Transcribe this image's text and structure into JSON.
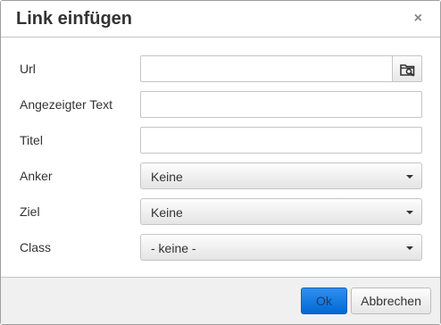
{
  "dialog": {
    "title": "Link einfügen",
    "close_symbol": "×"
  },
  "fields": {
    "url": {
      "label": "Url",
      "value": "",
      "browse_icon": "folder-search-icon"
    },
    "text": {
      "label": "Angezeigter Text",
      "value": ""
    },
    "title": {
      "label": "Titel",
      "value": ""
    },
    "anchor": {
      "label": "Anker",
      "selected": "Keine"
    },
    "target": {
      "label": "Ziel",
      "selected": "Keine"
    },
    "class": {
      "label": "Class",
      "selected": "- keine -"
    }
  },
  "buttons": {
    "ok": "Ok",
    "cancel": "Abbrechen"
  },
  "colors": {
    "primary": "#0069d4",
    "border": "#c5c5c5",
    "footer_bg": "#f0f0f0"
  }
}
